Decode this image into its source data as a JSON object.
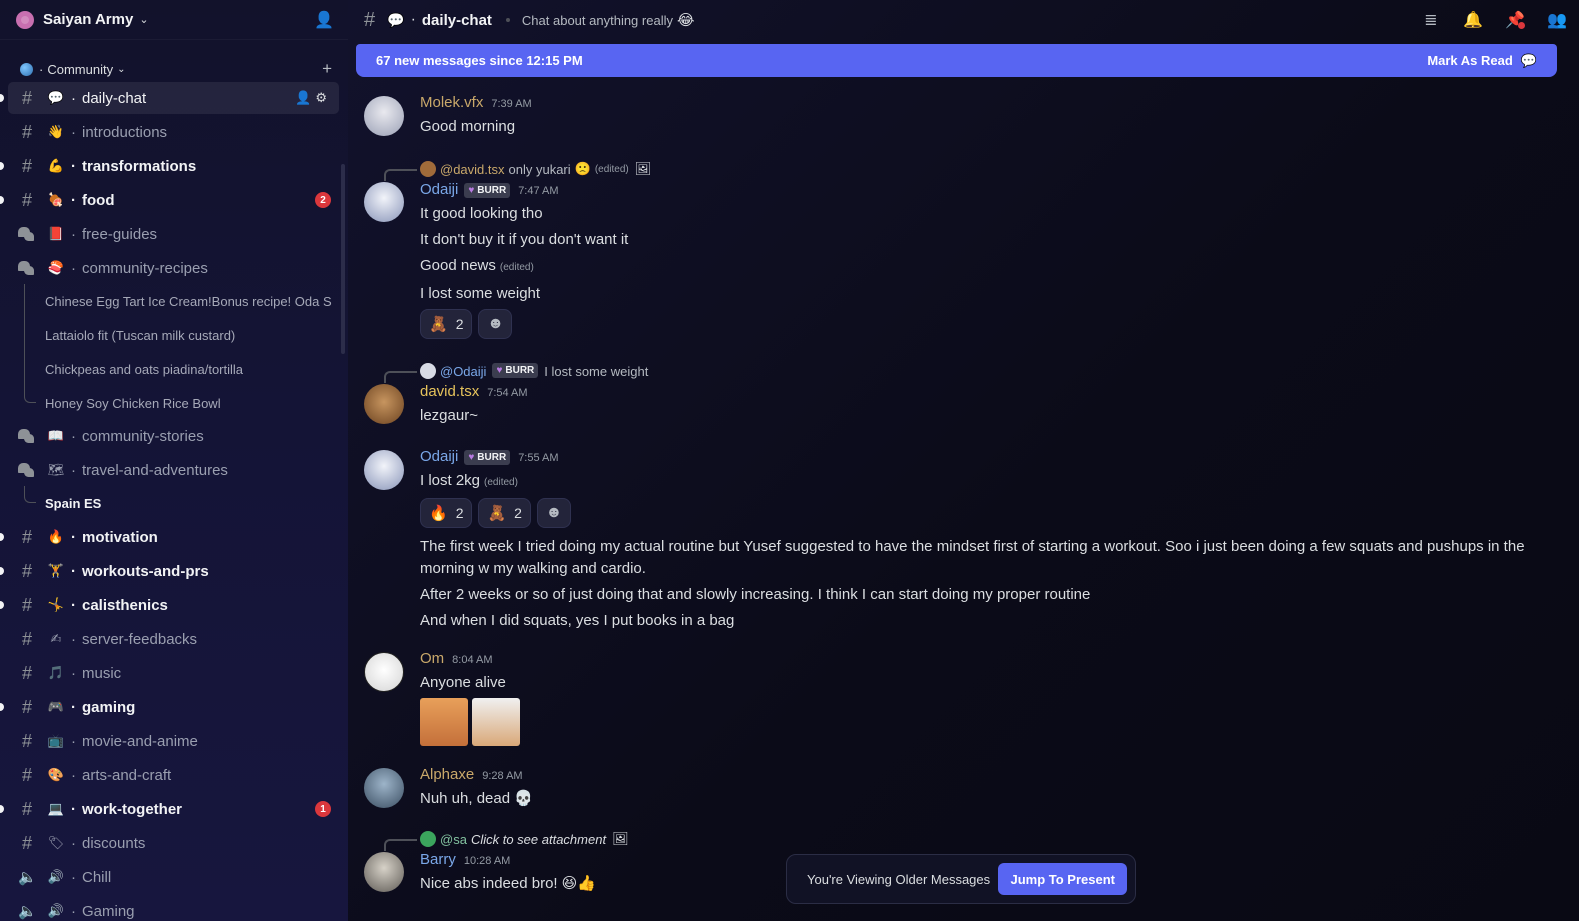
{
  "server": {
    "name": "Saiyan Army"
  },
  "category": {
    "name": "Community"
  },
  "channels": [
    {
      "name": "daily-chat",
      "emoji": "💬",
      "kind": "text",
      "state": "selected"
    },
    {
      "name": "introductions",
      "emoji": "👋",
      "kind": "text",
      "state": "read"
    },
    {
      "name": "transformations",
      "emoji": "💪",
      "kind": "text",
      "state": "unread"
    },
    {
      "name": "food",
      "emoji": "🍖",
      "kind": "text",
      "state": "unread",
      "badge": "2"
    },
    {
      "name": "free-guides",
      "emoji": "📕",
      "kind": "forum",
      "state": "read"
    },
    {
      "name": "community-recipes",
      "emoji": "🍣",
      "kind": "forum",
      "state": "read"
    }
  ],
  "threads": [
    "Chinese Egg Tart Ice Cream!Bonus recipe! Oda S",
    "Lattaiolo fit (Tuscan milk custard)",
    "Chickpeas and oats piadina/tortilla",
    "Honey Soy Chicken Rice Bowl"
  ],
  "channels2": [
    {
      "name": "community-stories",
      "emoji": "📖",
      "kind": "forum",
      "state": "read"
    },
    {
      "name": "travel-and-adventures",
      "emoji": "🗺",
      "kind": "forum",
      "state": "read"
    }
  ],
  "spain_thread": "Spain ES",
  "channels3": [
    {
      "name": "motivation",
      "emoji": "🔥",
      "kind": "text",
      "state": "unread"
    },
    {
      "name": "workouts-and-prs",
      "emoji": "🏋",
      "kind": "text",
      "state": "unread"
    },
    {
      "name": "calisthenics",
      "emoji": "🤸",
      "kind": "text",
      "state": "unread"
    },
    {
      "name": "server-feedbacks",
      "emoji": "✍",
      "kind": "text",
      "state": "read"
    },
    {
      "name": "music",
      "emoji": "🎵",
      "kind": "text",
      "state": "read"
    },
    {
      "name": "gaming",
      "emoji": "🎮",
      "kind": "text",
      "state": "unread"
    },
    {
      "name": "movie-and-anime",
      "emoji": "📺",
      "kind": "text",
      "state": "read"
    },
    {
      "name": "arts-and-craft",
      "emoji": "🎨",
      "kind": "text",
      "state": "read"
    },
    {
      "name": "work-together",
      "emoji": "💻",
      "kind": "text",
      "state": "unread",
      "badge": "1"
    },
    {
      "name": "discounts",
      "emoji": "🏷",
      "kind": "text",
      "state": "read"
    },
    {
      "name": "Chill",
      "emoji": "🔊",
      "kind": "voice",
      "state": "read"
    },
    {
      "name": "Gaming",
      "emoji": "🔊",
      "kind": "voice",
      "state": "read"
    }
  ],
  "topbar": {
    "channel": "daily-chat",
    "topic": "Chat about anything really",
    "topic_emoji": "😂"
  },
  "new_messages": {
    "text": "67 new messages since 12:15 PM",
    "mark_read": "Mark As Read"
  },
  "messages": {
    "m1": {
      "author": "Molek.vfx",
      "time": "7:39 AM",
      "lines": [
        "Good morning"
      ],
      "color": "#c9a86a"
    },
    "m2": {
      "reply_name": "@david.tsx",
      "reply_text": "only yukari",
      "author": "Odaiji",
      "role": "BURR",
      "time": "7:47 AM",
      "lines": [
        "It good looking tho",
        "It don't buy it if you don't want it",
        "Good news",
        "I lost some weight"
      ],
      "reaction_count": "2",
      "color": "#7aa7e8"
    },
    "m3": {
      "reply_name": "@Odaiji",
      "reply_role": "BURR",
      "reply_text": "I lost some weight",
      "author": "david.tsx",
      "time": "7:54 AM",
      "lines": [
        "lezgaur~"
      ],
      "color": "#e6c35c"
    },
    "m4": {
      "author": "Odaiji",
      "role": "BURR",
      "time": "7:55 AM",
      "lines": [
        "I lost 2kg",
        "The first week I tried doing my actual routine but Yusef suggested to have the mindset  first of starting a workout. Soo i just been doing a few squats and pushups in the morning w my walking and cardio.",
        "After 2 weeks or so of just doing that and slowly increasing. I think I can start doing my proper routine",
        "And when I did squats, yes I put books  in a bag"
      ],
      "reaction1_count": "2",
      "reaction2_count": "2",
      "color": "#7aa7e8"
    },
    "m5": {
      "author": "Om",
      "time": "8:04 AM",
      "lines": [
        "Anyone alive"
      ],
      "color": "#c9a86a"
    },
    "m6": {
      "author": "Alphaxe",
      "time": "9:28 AM",
      "lines": [
        "Nuh uh, dead"
      ],
      "color": "#c9a86a"
    },
    "m7": {
      "reply_name": "@sa",
      "reply_text": "Click to see attachment",
      "author": "Barry",
      "time": "10:28 AM",
      "lines": [
        "Nice abs indeed bro!"
      ],
      "color": "#7aa7e8"
    }
  },
  "edited_label": "(edited)",
  "older": {
    "text": "You're Viewing Older Messages",
    "button": "Jump To Present"
  }
}
